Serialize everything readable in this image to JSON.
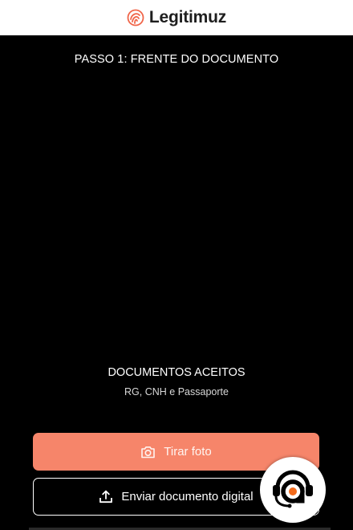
{
  "header": {
    "brand_name": "Legitimuz",
    "brand_icon": "fingerprint-icon",
    "brand_color": "#f0664a"
  },
  "step": {
    "title": "PASSO 1: FRENTE DO DOCUMENTO"
  },
  "accepted_documents": {
    "title": "DOCUMENTOS ACEITOS",
    "list": "RG, CNH e Passaporte"
  },
  "actions": {
    "take_photo_label": "Tirar foto",
    "take_photo_icon": "camera-icon",
    "upload_label": "Enviar documento digital",
    "upload_icon": "upload-icon"
  },
  "support_widget": {
    "icon": "headset-support-icon",
    "accent": "#f26a1b"
  },
  "colors": {
    "primary_button": "#f6856a",
    "background": "#000000"
  }
}
